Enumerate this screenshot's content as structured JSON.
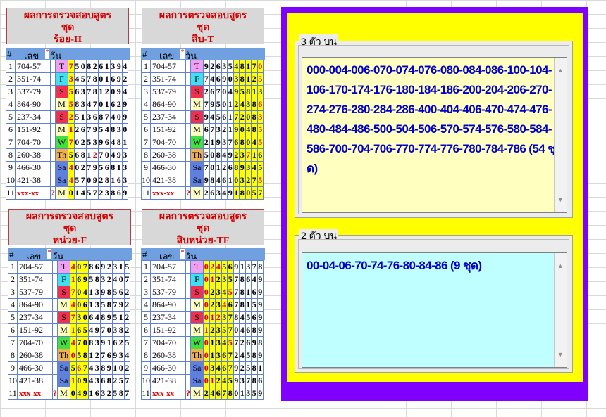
{
  "header_label": {
    "num": "#",
    "code": "เลข",
    "day": "วัน",
    "star": "*"
  },
  "tables": [
    {
      "title1": "ผลการตรวจสอบสูตร",
      "title2": "ชุด",
      "title3": "ร้อย-H",
      "hl": [
        0
      ],
      "rows": [
        {
          "n": "1",
          "code": "704-57",
          "day": "T",
          "dcolor": "#f0a0f0",
          "digits": "7508261394",
          "red": [
            0
          ]
        },
        {
          "n": "2",
          "code": "351-74",
          "day": "F",
          "dcolor": "#40e0f0",
          "digits": "3457801692",
          "red": [
            0
          ]
        },
        {
          "n": "3",
          "code": "537-79",
          "day": "S",
          "dcolor": "#f03050",
          "digits": "5637812094",
          "red": [
            0
          ]
        },
        {
          "n": "4",
          "code": "864-90",
          "day": "M",
          "dcolor": "#ffffc0",
          "digits": "5834701629",
          "red": [
            0
          ]
        },
        {
          "n": "5",
          "code": "237-34",
          "day": "S",
          "dcolor": "#f03050",
          "digits": "2513687409",
          "red": [
            0
          ]
        },
        {
          "n": "6",
          "code": "151-92",
          "day": "M",
          "dcolor": "#ffffc0",
          "digits": "1267954830",
          "red": [
            0
          ]
        },
        {
          "n": "7",
          "code": "704-70",
          "day": "W",
          "dcolor": "#40e040",
          "digits": "7025396481",
          "red": [
            0
          ]
        },
        {
          "n": "8",
          "code": "260-38",
          "day": "Th",
          "dcolor": "#f0b050",
          "digits": "5681270493",
          "red": [
            4
          ]
        },
        {
          "n": "9",
          "code": "466-30",
          "day": "Sa",
          "dcolor": "#6080e0",
          "digits": "4027956813",
          "red": [
            0
          ]
        },
        {
          "n": "10",
          "code": "421-38",
          "day": "Sa",
          "dcolor": "#6080e0",
          "digits": "4570928163",
          "red": [
            0
          ]
        },
        {
          "n": "11",
          "code": "xxx-xx",
          "q": "?",
          "day": "M",
          "dcolor": "#ffffc0",
          "digits": "0145723869",
          "red": []
        }
      ]
    },
    {
      "title1": "ผลการตรวจสอบสูตร",
      "title2": "ชุด",
      "title3": "สิบ-T",
      "hl": [
        5,
        6,
        7,
        8,
        9
      ],
      "rows": [
        {
          "n": "1",
          "code": "704-57",
          "day": "T",
          "dcolor": "#f0a0f0",
          "digits": "9263548170",
          "red": [
            9
          ]
        },
        {
          "n": "2",
          "code": "351-74",
          "day": "F",
          "dcolor": "#40e0f0",
          "digits": "7469038125",
          "red": [
            9
          ]
        },
        {
          "n": "3",
          "code": "537-79",
          "day": "S",
          "dcolor": "#f03050",
          "digits": "2670495813",
          "red": []
        },
        {
          "n": "4",
          "code": "864-90",
          "day": "M",
          "dcolor": "#ffffc0",
          "digits": "7950124386",
          "red": [
            9
          ]
        },
        {
          "n": "5",
          "code": "237-34",
          "day": "S",
          "dcolor": "#f03050",
          "digits": "9456172083",
          "red": [
            9
          ]
        },
        {
          "n": "6",
          "code": "151-92",
          "day": "M",
          "dcolor": "#ffffc0",
          "digits": "6732190485",
          "red": [
            9
          ]
        },
        {
          "n": "7",
          "code": "704-70",
          "day": "W",
          "dcolor": "#40e040",
          "digits": "2193768045",
          "red": [
            9
          ]
        },
        {
          "n": "8",
          "code": "260-38",
          "day": "Th",
          "dcolor": "#f0b050",
          "digits": "5084923716",
          "red": [
            7
          ]
        },
        {
          "n": "9",
          "code": "466-30",
          "day": "Sa",
          "dcolor": "#6080e0",
          "digits": "7012689345",
          "red": []
        },
        {
          "n": "10",
          "code": "421-38",
          "day": "Sa",
          "dcolor": "#6080e0",
          "digits": "9846103275",
          "red": [
            9
          ]
        },
        {
          "n": "11",
          "code": "xxx-xx",
          "q": "?",
          "day": "M",
          "dcolor": "#ffffc0",
          "digits": "2634918057",
          "red": []
        }
      ]
    },
    {
      "title1": "ผลการตรวจสอบสูตร",
      "title2": "ชุด",
      "title3": "หน่วย-F",
      "hl": [
        0,
        1,
        2
      ],
      "rows": [
        {
          "n": "1",
          "code": "704-57",
          "day": "T",
          "dcolor": "#f0a0f0",
          "digits": "4078692315",
          "red": [
            0
          ]
        },
        {
          "n": "2",
          "code": "351-74",
          "day": "F",
          "dcolor": "#40e0f0",
          "digits": "1695832407",
          "red": [
            0
          ]
        },
        {
          "n": "3",
          "code": "537-79",
          "day": "S",
          "dcolor": "#f03050",
          "digits": "7041398562",
          "red": [
            0
          ]
        },
        {
          "n": "4",
          "code": "864-90",
          "day": "M",
          "dcolor": "#ffffc0",
          "digits": "4061358792",
          "red": [
            0
          ]
        },
        {
          "n": "5",
          "code": "237-34",
          "day": "S",
          "dcolor": "#f03050",
          "digits": "7306489512",
          "red": [
            0
          ]
        },
        {
          "n": "6",
          "code": "151-92",
          "day": "M",
          "dcolor": "#ffffc0",
          "digits": "1654970382",
          "red": [
            0
          ]
        },
        {
          "n": "7",
          "code": "704-70",
          "day": "W",
          "dcolor": "#40e040",
          "digits": "4708391625",
          "red": [
            0
          ]
        },
        {
          "n": "8",
          "code": "260-38",
          "day": "Th",
          "dcolor": "#f0b050",
          "digits": "0581276934",
          "red": [
            0
          ]
        },
        {
          "n": "9",
          "code": "466-30",
          "day": "Sa",
          "dcolor": "#6080e0",
          "digits": "5674389102",
          "red": [
            1
          ]
        },
        {
          "n": "10",
          "code": "421-38",
          "day": "Sa",
          "dcolor": "#6080e0",
          "digits": "1094368257",
          "red": [
            0
          ]
        },
        {
          "n": "11",
          "code": "xxx-xx",
          "q": "?",
          "day": "M",
          "dcolor": "#ffffc0",
          "digits": "0491632587",
          "red": []
        }
      ]
    },
    {
      "title1": "ผลการตรวจสอบสูตร",
      "title2": "ชุด",
      "title3": "สิบหน่วย-TF",
      "hl": [
        0,
        1,
        2,
        3,
        4
      ],
      "rows": [
        {
          "n": "1",
          "code": "704-57",
          "day": "T",
          "dcolor": "#f0a0f0",
          "digits": "0245691378",
          "red": [
            0,
            1,
            2
          ]
        },
        {
          "n": "2",
          "code": "351-74",
          "day": "F",
          "dcolor": "#40e0f0",
          "digits": "0123578649",
          "red": [
            0,
            1
          ]
        },
        {
          "n": "3",
          "code": "537-79",
          "day": "S",
          "dcolor": "#f03050",
          "digits": "0234578169",
          "red": [
            0,
            4
          ]
        },
        {
          "n": "4",
          "code": "864-90",
          "day": "M",
          "dcolor": "#ffffc0",
          "digits": "0234678159",
          "red": [
            0,
            3
          ]
        },
        {
          "n": "5",
          "code": "237-34",
          "day": "S",
          "dcolor": "#f03050",
          "digits": "0123784569",
          "red": [
            0,
            1,
            2
          ]
        },
        {
          "n": "6",
          "code": "151-92",
          "day": "M",
          "dcolor": "#ffffc0",
          "digits": "1235704689",
          "red": [
            0
          ]
        },
        {
          "n": "7",
          "code": "704-70",
          "day": "W",
          "dcolor": "#40e040",
          "digits": "0134572698",
          "red": [
            0,
            4
          ]
        },
        {
          "n": "8",
          "code": "260-38",
          "day": "Th",
          "dcolor": "#f0b050",
          "digits": "0136724589",
          "red": [
            0
          ]
        },
        {
          "n": "9",
          "code": "466-30",
          "day": "Sa",
          "dcolor": "#6080e0",
          "digits": "0346792581",
          "red": [
            0
          ]
        },
        {
          "n": "10",
          "code": "421-38",
          "day": "Sa",
          "dcolor": "#6080e0",
          "digits": "0124593786",
          "red": [
            0,
            1
          ]
        },
        {
          "n": "11",
          "code": "xxx-xx",
          "q": "?",
          "day": "M",
          "dcolor": "#ffffc0",
          "digits": "2467801359",
          "red": []
        }
      ]
    }
  ],
  "panel3": {
    "label": "3 ตัว บน",
    "text": "000-004-006-070-074-076-080-084-086-100-104-106-170-174-176-180-184-186-200-204-206-270-274-276-280-284-286-400-404-406-470-474-476-480-484-486-500-504-506-570-574-576-580-584-586-700-704-706-770-774-776-780-784-786  (54 ชุด)",
    "bg": "#ffffc0"
  },
  "panel2": {
    "label": "2 ตัว บน",
    "text": "00-04-06-70-74-76-80-84-86 (9 ชุด)",
    "bg": "#c0ffff"
  },
  "colors": {
    "purple": "#8000ff",
    "yellow": "#ffff00"
  }
}
